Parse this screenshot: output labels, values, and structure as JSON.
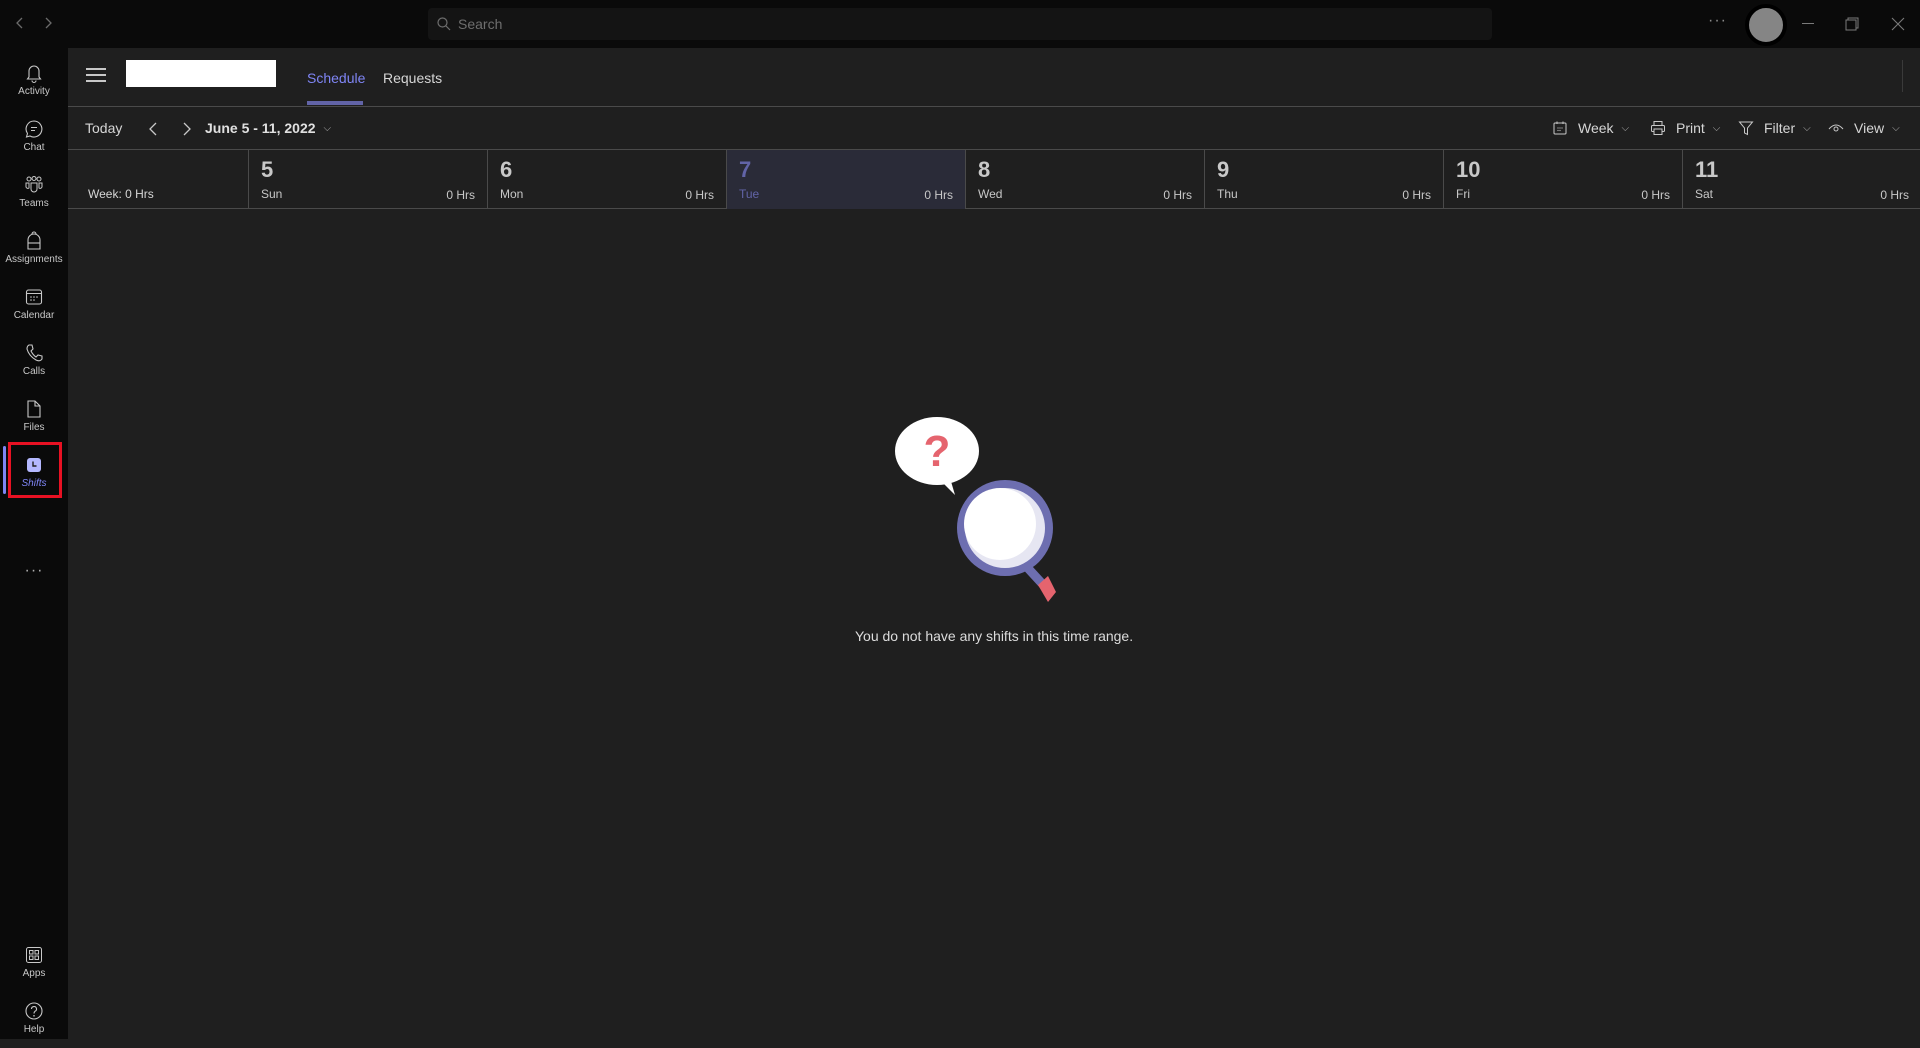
{
  "titlebar": {
    "search_placeholder": "Search",
    "more_label": "···"
  },
  "rail": {
    "items": [
      {
        "label": "Activity",
        "icon": "bell-icon"
      },
      {
        "label": "Chat",
        "icon": "chat-icon"
      },
      {
        "label": "Teams",
        "icon": "teams-icon"
      },
      {
        "label": "Assignments",
        "icon": "backpack-icon"
      },
      {
        "label": "Calendar",
        "icon": "calendar-icon"
      },
      {
        "label": "Calls",
        "icon": "phone-icon"
      },
      {
        "label": "Files",
        "icon": "file-icon"
      },
      {
        "label": "Shifts",
        "icon": "clock-icon",
        "active": true
      }
    ],
    "more_label": "···",
    "bottom": [
      {
        "label": "Apps",
        "icon": "apps-icon"
      },
      {
        "label": "Help",
        "icon": "help-icon"
      }
    ]
  },
  "appbar": {
    "tabs": [
      {
        "label": "Schedule",
        "active": true
      },
      {
        "label": "Requests",
        "active": false
      }
    ],
    "more_label": "···"
  },
  "toolbar": {
    "today_label": "Today",
    "date_range": "June 5 - 11, 2022",
    "week_label": "Week",
    "print_label": "Print",
    "filter_label": "Filter",
    "view_label": "View"
  },
  "schedule": {
    "week_total": "Week: 0 Hrs",
    "days": [
      {
        "num": "5",
        "name": "Sun",
        "hrs": "0 Hrs"
      },
      {
        "num": "6",
        "name": "Mon",
        "hrs": "0 Hrs"
      },
      {
        "num": "7",
        "name": "Tue",
        "hrs": "0 Hrs",
        "today": true
      },
      {
        "num": "8",
        "name": "Wed",
        "hrs": "0 Hrs"
      },
      {
        "num": "9",
        "name": "Thu",
        "hrs": "0 Hrs"
      },
      {
        "num": "10",
        "name": "Fri",
        "hrs": "0 Hrs"
      },
      {
        "num": "11",
        "name": "Sat",
        "hrs": "0 Hrs"
      }
    ]
  },
  "empty_state": {
    "message": "You do not have any shifts in this time range.",
    "question_mark": "?"
  },
  "colors": {
    "accent": "#6264a7",
    "accent_light": "#7f85f5",
    "highlight": "#e81123",
    "illustration_red": "#e5646e"
  }
}
